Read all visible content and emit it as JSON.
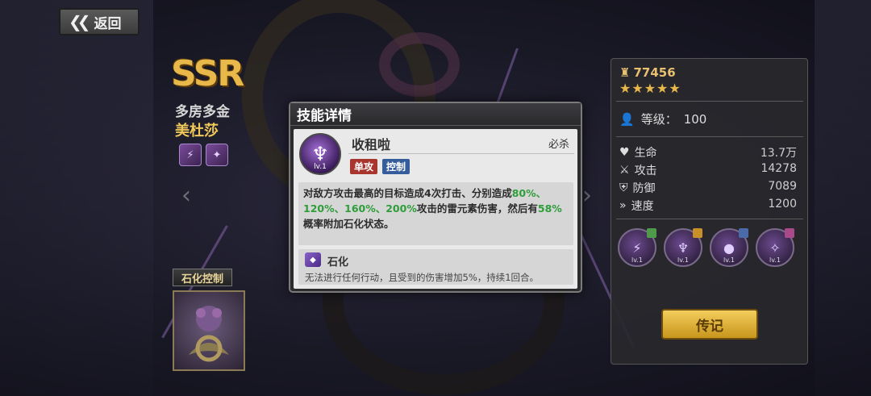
{
  "back_button": {
    "label": "返回"
  },
  "hero": {
    "rarity": "SSR",
    "title": "多房多金",
    "name": "美杜莎",
    "skin_label": "石化控制"
  },
  "stats_panel": {
    "power": "77456",
    "stars": "★★★★★",
    "level_label": "等级：",
    "level_value": "100",
    "stats": [
      {
        "name": "生命",
        "value": "13.7万"
      },
      {
        "name": "攻击",
        "value": "14278"
      },
      {
        "name": "防御",
        "value": "7089"
      },
      {
        "name": "速度",
        "value": "1200"
      }
    ],
    "skills": [
      {
        "lv": "lv.1",
        "tag_color": "#4f9a4a"
      },
      {
        "lv": "lv.1",
        "tag_color": "#c9902a"
      },
      {
        "lv": "lv.1",
        "tag_color": "#4a6aa8"
      },
      {
        "lv": "lv.1",
        "tag_color": "#a84a8a"
      }
    ],
    "legend_button": "传记"
  },
  "dialog": {
    "title": "技能详情",
    "skill_name": "收租啦",
    "skill_type": "必杀",
    "skill_lv": "lv.1",
    "badges": [
      "单攻",
      "控制"
    ],
    "desc_parts": [
      {
        "text": "对敌方攻击最高的目标造成4次打击、分别造成",
        "green": false
      },
      {
        "text": "80%、120%、160%、200%",
        "green": true
      },
      {
        "text": "攻击的雷元素伤害，然后有",
        "green": false
      },
      {
        "text": "58%",
        "green": true
      },
      {
        "text": "概率附加石化状态。",
        "green": false
      }
    ],
    "effect_name": "石化",
    "effect_desc": "无法进行任何行动，且受到的伤害增加5%，持续1回合。"
  }
}
